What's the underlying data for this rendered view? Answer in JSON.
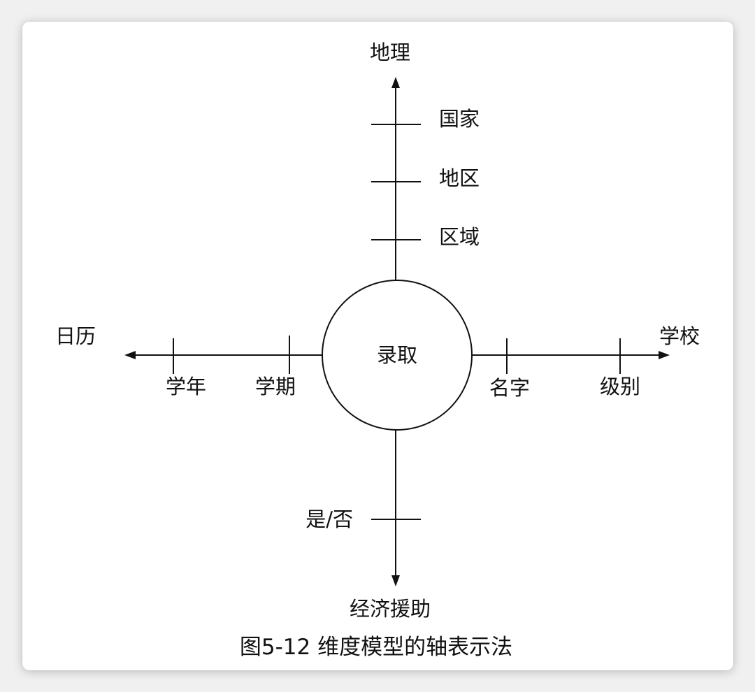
{
  "center": {
    "label": "录取"
  },
  "axes": {
    "top": {
      "label": "地理",
      "levels": [
        "国家",
        "地区",
        "区域"
      ]
    },
    "left": {
      "label": "日历",
      "levels": [
        "学年",
        "学期"
      ]
    },
    "right": {
      "label": "学校",
      "levels": [
        "名字",
        "级别"
      ]
    },
    "bottom": {
      "label": "经济援助",
      "levels": [
        "是/否"
      ]
    }
  },
  "caption": "图5-12 维度模型的轴表示法"
}
